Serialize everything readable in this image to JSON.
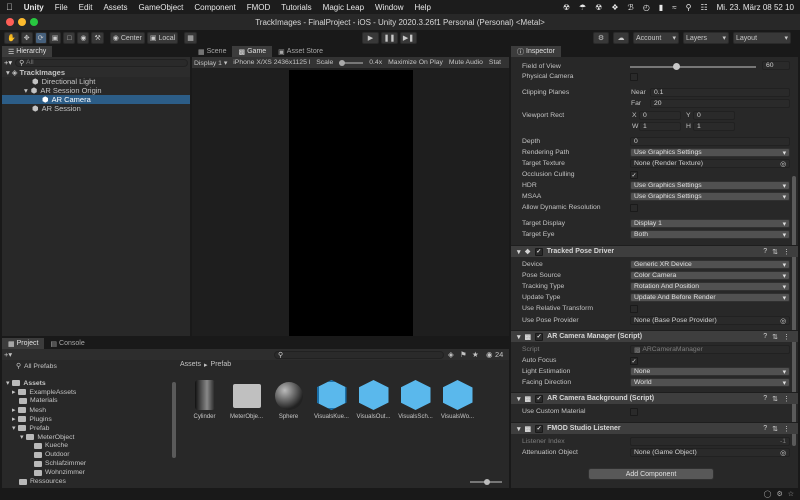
{
  "menubar": {
    "app": "Unity",
    "items": [
      "File",
      "Edit",
      "Assets",
      "GameObject",
      "Component",
      "FMOD",
      "Tutorials",
      "Magic Leap",
      "Window",
      "Help"
    ],
    "clock": "Mi. 23. März  08 52 10"
  },
  "window": {
    "title": "TrackImages - FinalProject - iOS - Unity 2020.3.26f1 Personal (Personal) <Metal>"
  },
  "toolbar": {
    "center": "Center",
    "local": "Local",
    "account": "Account",
    "layers": "Layers",
    "layout": "Layout"
  },
  "hierarchy": {
    "tab": "Hierarchy",
    "search": "All",
    "scene": "TrackImages",
    "items": [
      "Directional Light",
      "AR Session Origin",
      "AR Camera",
      "AR Session"
    ]
  },
  "scene_tabs": {
    "scene": "Scene",
    "game": "Game",
    "store": "Asset Store"
  },
  "game_bar": {
    "display": "Display 1",
    "resolution": "iPhone X/XS 2436x1125 l",
    "scale_label": "Scale",
    "scale": "0.4x",
    "maximize": "Maximize On Play",
    "mute": "Mute Audio",
    "stats": "Stat"
  },
  "project": {
    "tab_project": "Project",
    "tab_console": "Console",
    "all_prefabs": "All Prefabs",
    "count": "24",
    "breadcrumb": [
      "Assets",
      "Prefab"
    ],
    "tree": [
      "Assets",
      "ExampleAssets",
      "Materials",
      "Mesh",
      "Plugins",
      "Prefab",
      "MeterObject",
      "Kueche",
      "Outdoor",
      "Schlafzimmer",
      "Wohnzimmer",
      "Ressources"
    ],
    "assets": [
      "Cylinder",
      "MeterObje...",
      "Sphere",
      "VisualsKue...",
      "VisualsOut...",
      "VisualsSch...",
      "VisualsWo..."
    ]
  },
  "inspector": {
    "tab": "Inspector",
    "camera": {
      "fov_label": "Field of View",
      "fov": "60",
      "physical": "Physical Camera",
      "clipping": "Clipping Planes",
      "near_label": "Near",
      "near": "0.1",
      "far_label": "Far",
      "far": "20",
      "viewport": "Viewport Rect",
      "x_label": "X",
      "x": "0",
      "y_label": "Y",
      "y": "0",
      "w_label": "W",
      "w": "1",
      "h_label": "H",
      "h": "1",
      "depth_label": "Depth",
      "depth": "0",
      "rendering_path": "Rendering Path",
      "rendering_path_val": "Use Graphics Settings",
      "target_texture": "Target Texture",
      "target_texture_val": "None (Render Texture)",
      "occlusion": "Occlusion Culling",
      "hdr": "HDR",
      "hdr_val": "Use Graphics Settings",
      "msaa": "MSAA",
      "msaa_val": "Use Graphics Settings",
      "dyn_res": "Allow Dynamic Resolution",
      "target_display": "Target Display",
      "target_display_val": "Display 1",
      "target_eye": "Target Eye",
      "target_eye_val": "Both"
    },
    "tpd": {
      "title": "Tracked Pose Driver",
      "device": "Device",
      "device_val": "Generic XR Device",
      "pose_source": "Pose Source",
      "pose_source_val": "Color Camera",
      "tracking_type": "Tracking Type",
      "tracking_type_val": "Rotation And Position",
      "update_type": "Update Type",
      "update_type_val": "Update And Before Render",
      "relative": "Use Relative Transform",
      "provider": "Use Pose Provider",
      "provider_val": "None (Base Pose Provider)"
    },
    "arcm": {
      "title": "AR Camera Manager (Script)",
      "script": "Script",
      "script_val": "ARCameraManager",
      "autofocus": "Auto Focus",
      "light": "Light Estimation",
      "light_val": "None",
      "facing": "Facing Direction",
      "facing_val": "World"
    },
    "arcb": {
      "title": "AR Camera Background (Script)",
      "custom_mat": "Use Custom Material"
    },
    "fmod": {
      "title": "FMOD Studio Listener",
      "listener": "Listener Index",
      "listener_val": "-1",
      "attenuation": "Attenuation Object",
      "attenuation_val": "None (Game Object)"
    },
    "add_component": "Add Component"
  },
  "colors": {
    "accent": "#2c5d87",
    "bg": "#282828",
    "header": "#3e3e3e"
  }
}
